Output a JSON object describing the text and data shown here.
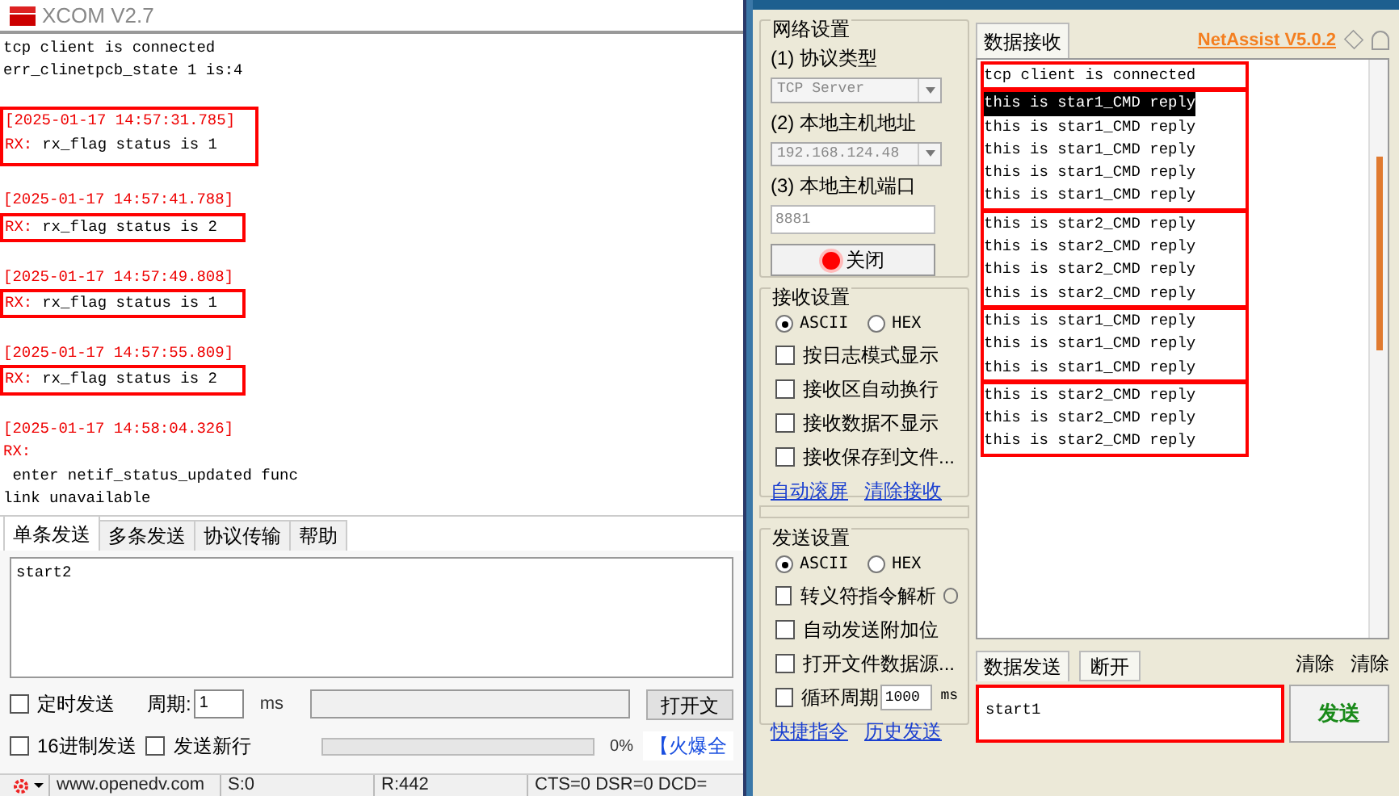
{
  "xcom": {
    "title": "XCOM V2.7",
    "log_header": [
      "tcp client is connected",
      "err_clinetpcb_state 1 is:4"
    ],
    "entries": [
      {
        "timestamp": "[2025-01-17 14:57:31.785]",
        "prefix": "RX:",
        "text": "rx_flag status is 1",
        "boxed": true,
        "box_includes_timestamp": true
      },
      {
        "timestamp": "[2025-01-17 14:57:41.788]",
        "prefix": "RX:",
        "text": "rx_flag status is 2",
        "boxed": true,
        "box_includes_timestamp": false
      },
      {
        "timestamp": "[2025-01-17 14:57:49.808]",
        "prefix": "RX:",
        "text": "rx_flag status is 1",
        "boxed": true,
        "box_includes_timestamp": false
      },
      {
        "timestamp": "[2025-01-17 14:57:55.809]",
        "prefix": "RX:",
        "text": "rx_flag status is 2",
        "boxed": true,
        "box_includes_timestamp": false
      },
      {
        "timestamp": "[2025-01-17 14:58:04.326]",
        "prefix": "RX:",
        "extra_lines": [
          " enter netif_status_updated func",
          "link unavailable"
        ]
      }
    ],
    "send_tabs": [
      {
        "label": "单条发送",
        "selected": true
      },
      {
        "label": "多条发送",
        "selected": false
      },
      {
        "label": "协议传输",
        "selected": false
      },
      {
        "label": "帮助",
        "selected": false
      }
    ],
    "send_text": "start2",
    "timed_send": {
      "label": "定时发送",
      "checked": false
    },
    "period_label": "周期:",
    "period_value": "1",
    "period_unit": "ms",
    "file_button": "打开文",
    "hex_send": {
      "label": "16进制发送",
      "checked": false
    },
    "send_newline": {
      "label": "发送新行",
      "checked": false
    },
    "progress": {
      "level": 0,
      "reading": "0%"
    },
    "promo_link": "【火爆全",
    "status_bar": {
      "site": "www.openedv.com",
      "sent": "S:0",
      "received": "R:442",
      "signals": "CTS=0 DSR=0 DCD="
    }
  },
  "netassist": {
    "brand": "NetAssist V5.0.2",
    "network": {
      "title": "网络设置",
      "protocol_label": "(1) 协议类型",
      "protocol": "TCP Server",
      "address_label": "(2) 本地主机地址",
      "address": "192.168.124.48",
      "port_label": "(3) 本地主机端口",
      "port": "8881",
      "button": "关闭"
    },
    "receive_settings": {
      "title": "接收设置",
      "encodings": [
        {
          "label": "ASCII",
          "selected": true
        },
        {
          "label": "HEX",
          "selected": false
        }
      ],
      "options": [
        {
          "label": "按日志模式显示",
          "checked": false
        },
        {
          "label": "接收区自动换行",
          "checked": false
        },
        {
          "label": "接收数据不显示",
          "checked": false
        },
        {
          "label": "接收保存到文件...",
          "checked": false
        }
      ],
      "links": [
        "自动滚屏",
        "清除接收"
      ]
    },
    "send_settings": {
      "title": "发送设置",
      "encodings": [
        {
          "label": "ASCII",
          "selected": true
        },
        {
          "label": "HEX",
          "selected": false
        }
      ],
      "options": [
        {
          "label": "转义符指令解析",
          "checked": false,
          "info": true
        },
        {
          "label": "自动发送附加位",
          "checked": false
        },
        {
          "label": "打开文件数据源...",
          "checked": false
        }
      ],
      "loop": {
        "label": "循环周期",
        "checked": false,
        "value": "1000",
        "unit": "ms"
      },
      "links": [
        "快捷指令",
        "历史发送"
      ]
    },
    "receive_tab": "数据接收",
    "received": [
      {
        "boxed": true,
        "lines": [
          {
            "text": "tcp client is connected",
            "selected": false
          }
        ]
      },
      {
        "boxed": true,
        "lines": [
          {
            "text": "this is star1_CMD reply",
            "selected": true
          },
          {
            "text": "this is star1_CMD reply",
            "selected": false
          },
          {
            "text": "this is star1_CMD reply",
            "selected": false
          },
          {
            "text": "this is star1_CMD reply",
            "selected": false
          },
          {
            "text": "this is star1_CMD reply",
            "selected": false
          }
        ]
      },
      {
        "boxed": true,
        "lines": [
          {
            "text": "this is star2_CMD reply",
            "selected": false
          },
          {
            "text": "this is star2_CMD reply",
            "selected": false
          },
          {
            "text": "this is star2_CMD reply",
            "selected": false
          },
          {
            "text": "this is star2_CMD reply",
            "selected": false
          }
        ]
      },
      {
        "boxed": true,
        "lines": [
          {
            "text": "this is star1_CMD reply",
            "selected": false
          },
          {
            "text": "this is star1_CMD reply",
            "selected": false
          },
          {
            "text": "this is star1_CMD reply",
            "selected": false
          }
        ]
      },
      {
        "boxed": true,
        "lines": [
          {
            "text": "this is star2_CMD reply",
            "selected": false
          },
          {
            "text": "this is star2_CMD reply",
            "selected": false
          },
          {
            "text": "this is star2_CMD reply",
            "selected": false
          }
        ]
      }
    ],
    "send_tab": "数据发送",
    "disconnect_button": "断开",
    "clear_buttons": [
      "清除",
      "清除"
    ],
    "send_text": "start1",
    "send_text_boxed": true,
    "send_button": "发送"
  }
}
